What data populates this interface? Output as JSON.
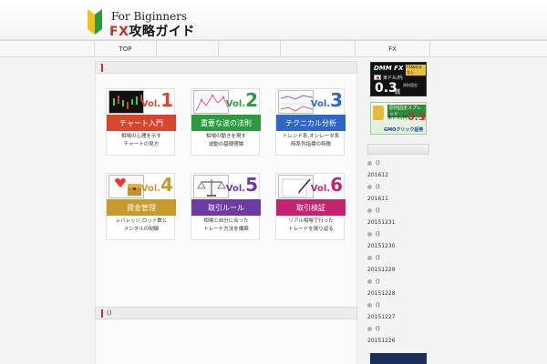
{
  "header": {
    "tagline": "For Biginners",
    "logo_prefix": "FX",
    "logo_rest": "攻略ガイド"
  },
  "nav": {
    "items": [
      {
        "label": "TOP"
      },
      {
        "label": ""
      },
      {
        "label": ""
      },
      {
        "label": ""
      },
      {
        "label": "FX"
      }
    ]
  },
  "main": {
    "section1_title": "",
    "section2_title": "()"
  },
  "cards": [
    {
      "vol_prefix": "Vol.",
      "vol_num": "1",
      "title": "チャート入門",
      "desc": [
        "相場の心理を示す",
        "チャートの見方"
      ],
      "color": "#d9452c",
      "num_color": "#d9452c",
      "icon": "candlestick-chart-icon"
    },
    {
      "vol_prefix": "Vol.",
      "vol_num": "2",
      "title": "重要な波の法則",
      "desc": [
        "相場の動きを現す",
        "波動の基礎理論"
      ],
      "color": "#2c9a3f",
      "num_color": "#2c9a3f",
      "icon": "wave-chart-icon"
    },
    {
      "vol_prefix": "Vol.",
      "vol_num": "3",
      "title": "テクニカル分析",
      "desc": [
        "トレンド系,オシレータ系",
        "時系列指標の特徴"
      ],
      "color": "#2f66c8",
      "num_color": "#2f66c8",
      "icon": "indicator-chart-icon"
    },
    {
      "vol_prefix": "Vol.",
      "vol_num": "4",
      "title": "資金管理",
      "desc": [
        "レバレッジ,ロット数と",
        "メンタルの制御"
      ],
      "color": "#c79a2a",
      "num_color": "#c79a2a",
      "icon": "treasure-chest-icon"
    },
    {
      "vol_prefix": "Vol.",
      "vol_num": "5",
      "title": "取引ルール",
      "desc": [
        "相場と自分に合った",
        "トレード方法を構築"
      ],
      "color": "#6e3aa6",
      "num_color": "#6e3aa6",
      "icon": "scales-icon"
    },
    {
      "vol_prefix": "Vol.",
      "vol_num": "6",
      "title": "取引検証",
      "desc": [
        "リアル相場で行った",
        "トレードを振り返る"
      ],
      "color": "#c4246f",
      "num_color": "#c4246f",
      "icon": "pen-notepad-icon"
    }
  ],
  "sidebar": {
    "banner1": {
      "brand": "DMM FX",
      "badge": "FX始めるなら",
      "pair": "米ドル/円",
      "spread": "0.3",
      "unit": "銭",
      "note": "原則固定"
    },
    "banner2": {
      "title": "原則固定スプレッド",
      "pair": "米ドル/円",
      "spread": "0.3",
      "unit": "銭",
      "brand": "GMOクリック証券"
    },
    "archives": [
      {
        "bullet": "()",
        "label": "201612"
      },
      {
        "bullet": "()",
        "label": "201611"
      },
      {
        "bullet": "()",
        "label": "20151231"
      },
      {
        "bullet": "()",
        "label": "20151230"
      },
      {
        "bullet": "()",
        "label": "20151229"
      },
      {
        "bullet": "()",
        "label": "20151228"
      },
      {
        "bullet": "()",
        "label": "20151227"
      },
      {
        "bullet": "()",
        "label": "20151226"
      }
    ]
  },
  "colors": {
    "accent": "#c0352b",
    "background": "#f3f3f3"
  }
}
